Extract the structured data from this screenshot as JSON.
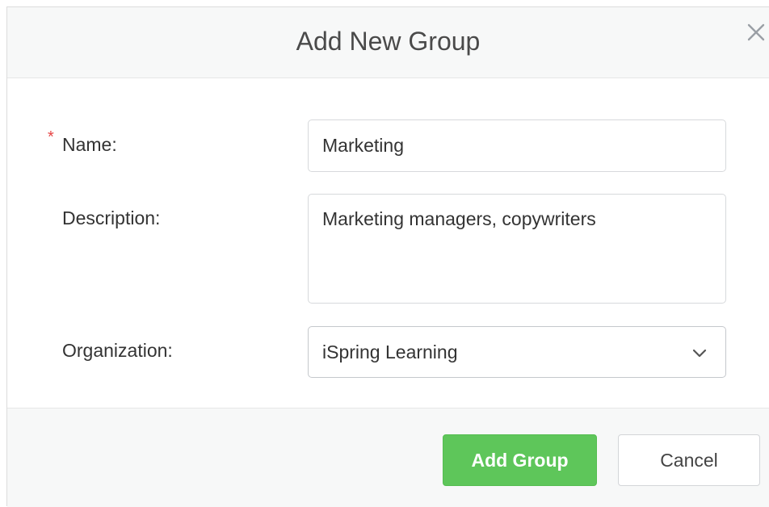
{
  "dialog": {
    "title": "Add New Group",
    "close_icon": "close-icon"
  },
  "form": {
    "name": {
      "required_marker": "*",
      "label": "Name:",
      "value": "Marketing"
    },
    "description": {
      "label": "Description:",
      "value": "Marketing managers, copywriters"
    },
    "organization": {
      "label": "Organization:",
      "selected": "iSpring Learning",
      "icon": "chevron-down-icon"
    }
  },
  "footer": {
    "add_label": "Add Group",
    "cancel_label": "Cancel"
  },
  "colors": {
    "primary_button": "#5ec65a",
    "required_star": "#e64545",
    "header_bg": "#f7f8f8"
  }
}
